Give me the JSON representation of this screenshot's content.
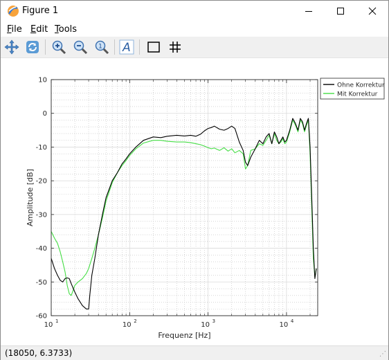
{
  "window": {
    "title": "Figure 1"
  },
  "menu": [
    {
      "label": "File",
      "underline": "F"
    },
    {
      "label": "Edit",
      "underline": "E"
    },
    {
      "label": "Tools",
      "underline": "T"
    }
  ],
  "toolbar": {
    "tools": [
      "pan-icon",
      "rotate-icon",
      "zoom-in-icon",
      "zoom-out-icon",
      "reset-zoom-icon",
      "text-annotation-icon",
      "box-icon",
      "grid-icon"
    ]
  },
  "status": {
    "coords": "(18050, 6.3733)"
  },
  "chart_data": {
    "type": "line",
    "xscale": "log",
    "xlabel": "Frequenz [Hz]",
    "ylabel": "Amplitude [dB]",
    "xlim": [
      10,
      25000
    ],
    "ylim": [
      -60,
      10
    ],
    "yticks": [
      10,
      0,
      -10,
      -20,
      -30,
      -40,
      -50,
      -60
    ],
    "xticks": [
      {
        "base": "10",
        "exp": "1"
      },
      {
        "base": "10",
        "exp": "2"
      },
      {
        "base": "10",
        "exp": "3"
      },
      {
        "base": "10",
        "exp": "4"
      }
    ],
    "grid": true,
    "legend_position": "outside-top-right",
    "series": [
      {
        "name": "Ohne Korrektur",
        "color": "#000000",
        "x": [
          10,
          11,
          12,
          13,
          14,
          15,
          16,
          17,
          18,
          20,
          22,
          25,
          28,
          30,
          31,
          33,
          36,
          40,
          45,
          50,
          60,
          70,
          80,
          90,
          100,
          120,
          150,
          200,
          250,
          300,
          400,
          500,
          600,
          700,
          800,
          900,
          1000,
          1100,
          1200,
          1400,
          1600,
          1800,
          2000,
          2200,
          2500,
          2800,
          3000,
          3200,
          3500,
          4000,
          4500,
          5000,
          5500,
          6000,
          6500,
          7000,
          7500,
          8000,
          8500,
          9000,
          9500,
          10000,
          11000,
          12000,
          13000,
          14000,
          15000,
          16000,
          17000,
          18000,
          19000,
          20000,
          21000,
          22000,
          23000,
          24000
        ],
        "y": [
          -43,
          -46,
          -48,
          -49.5,
          -50,
          -49,
          -48.8,
          -49,
          -50.5,
          -53,
          -55,
          -57,
          -58,
          -58,
          -54,
          -48,
          -43,
          -36,
          -30,
          -25,
          -20,
          -17.5,
          -15,
          -13.5,
          -12,
          -10,
          -8,
          -7,
          -7.2,
          -6.8,
          -6.5,
          -6.7,
          -6.5,
          -6.8,
          -6.2,
          -5.2,
          -4.5,
          -4.2,
          -3.8,
          -4.7,
          -5,
          -4.5,
          -3.8,
          -4.5,
          -8.5,
          -11,
          -14.5,
          -15.5,
          -13,
          -10.5,
          -8,
          -9,
          -7,
          -6,
          -9,
          -5.5,
          -7,
          -9,
          -8,
          -7,
          -8.5,
          -8,
          -5,
          -1.5,
          -3,
          -5,
          -1.5,
          -2.5,
          -5,
          -3,
          -1.5,
          -10,
          -25,
          -40,
          -49,
          -46
        ]
      },
      {
        "name": "Mit Korrektur",
        "color": "#44dd44",
        "x": [
          10,
          11,
          12,
          13,
          14,
          15,
          16,
          17,
          18,
          19,
          20,
          22,
          25,
          28,
          30,
          33,
          36,
          40,
          45,
          50,
          60,
          70,
          80,
          90,
          100,
          120,
          150,
          200,
          250,
          300,
          400,
          500,
          600,
          700,
          800,
          900,
          1000,
          1100,
          1200,
          1400,
          1600,
          1800,
          2000,
          2200,
          2500,
          2800,
          3000,
          3200,
          3500,
          4000,
          4500,
          5000,
          5500,
          6000,
          6500,
          7000,
          7500,
          8000,
          8500,
          9000,
          9500,
          10000,
          11000,
          12000,
          13000,
          14000,
          15000,
          16000,
          17000,
          18000,
          19000,
          20000,
          21000,
          22000,
          23000,
          24000
        ],
        "y": [
          -35,
          -37,
          -38.5,
          -41,
          -44,
          -47,
          -51,
          -53.5,
          -54,
          -52.5,
          -51,
          -50,
          -49,
          -47.5,
          -46,
          -43,
          -40,
          -36,
          -31,
          -26,
          -20.5,
          -17.5,
          -15.5,
          -14,
          -12.5,
          -10.5,
          -8.8,
          -8,
          -8,
          -8.3,
          -8.5,
          -8.5,
          -8.7,
          -9,
          -9.3,
          -9.7,
          -10.2,
          -10.5,
          -10.3,
          -11,
          -10.2,
          -11.2,
          -10.5,
          -11.7,
          -11,
          -12,
          -16.5,
          -15.5,
          -11,
          -10.5,
          -9,
          -9.5,
          -8,
          -6.5,
          -9,
          -6,
          -8,
          -9,
          -8.5,
          -7.5,
          -9,
          -8.5,
          -5.5,
          -2,
          -3.5,
          -5.5,
          -2,
          -3,
          -5.5,
          -3.5,
          -2,
          -12,
          -28,
          -43,
          -48.5,
          -46
        ]
      }
    ]
  }
}
